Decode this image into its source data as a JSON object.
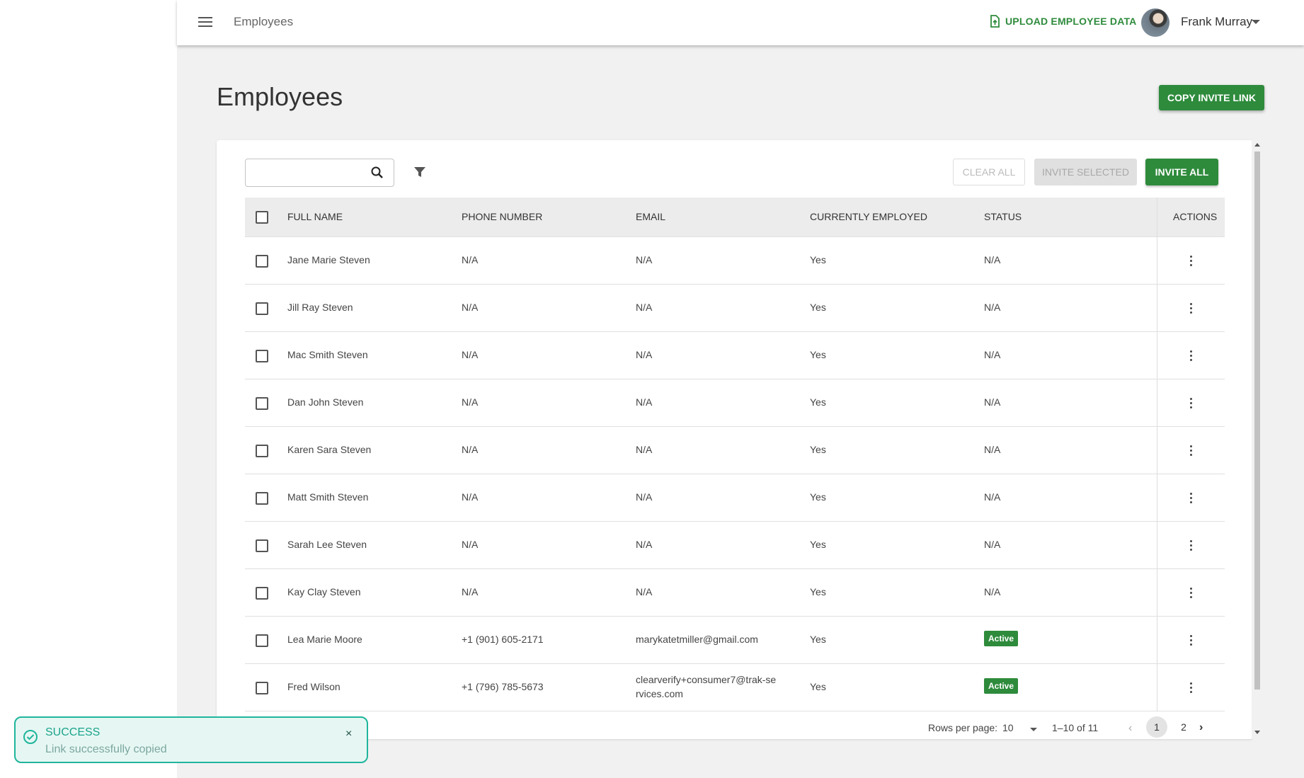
{
  "topbar": {
    "title": "Employees",
    "upload_label": "UPLOAD EMPLOYEE DATA",
    "user_name": "Frank Murray"
  },
  "page": {
    "title": "Employees",
    "copy_invite_label": "COPY INVITE LINK"
  },
  "toolbar": {
    "search_placeholder": "",
    "search_value": "",
    "clear_all_label": "CLEAR ALL",
    "invite_selected_label": "INVITE SELECTED",
    "invite_all_label": "INVITE ALL"
  },
  "table": {
    "headers": {
      "full_name": "FULL NAME",
      "phone": "PHONE NUMBER",
      "email": "EMAIL",
      "employed": "CURRENTLY EMPLOYED",
      "status": "STATUS",
      "actions": "ACTIONS"
    },
    "rows": [
      {
        "name": "Jane Marie Steven",
        "phone": "N/A",
        "email": "N/A",
        "employed": "Yes",
        "status": "N/A"
      },
      {
        "name": "Jill Ray Steven",
        "phone": "N/A",
        "email": "N/A",
        "employed": "Yes",
        "status": "N/A"
      },
      {
        "name": "Mac Smith Steven",
        "phone": "N/A",
        "email": "N/A",
        "employed": "Yes",
        "status": "N/A"
      },
      {
        "name": "Dan John Steven",
        "phone": "N/A",
        "email": "N/A",
        "employed": "Yes",
        "status": "N/A"
      },
      {
        "name": "Karen Sara Steven",
        "phone": "N/A",
        "email": "N/A",
        "employed": "Yes",
        "status": "N/A"
      },
      {
        "name": "Matt Smith Steven",
        "phone": "N/A",
        "email": "N/A",
        "employed": "Yes",
        "status": "N/A"
      },
      {
        "name": "Sarah Lee Steven",
        "phone": "N/A",
        "email": "N/A",
        "employed": "Yes",
        "status": "N/A"
      },
      {
        "name": "Kay Clay Steven",
        "phone": "N/A",
        "email": "N/A",
        "employed": "Yes",
        "status": "N/A"
      },
      {
        "name": "Lea Marie Moore",
        "phone": "+1 (901) 605-2171",
        "email": "marykatetmiller@gmail.com",
        "employed": "Yes",
        "status": "Active"
      },
      {
        "name": "Fred Wilson",
        "phone": "+1 (796) 785-5673",
        "email": "clearverify+consumer7@trak-services.com",
        "employed": "Yes",
        "status": "Active"
      }
    ]
  },
  "pagination": {
    "rows_per_page_label": "Rows per page:",
    "rows_per_page_value": "10",
    "range": "1–10 of 11",
    "pages": [
      "1",
      "2"
    ],
    "current_page": "1",
    "prev": "‹",
    "next": "›"
  },
  "toast": {
    "title": "SUCCESS",
    "message": "Link successfully copied",
    "close": "×"
  },
  "colors": {
    "primary_green": "#2e8b3c",
    "toast_border": "#1fb59c",
    "toast_bg": "#e6f7f3"
  }
}
